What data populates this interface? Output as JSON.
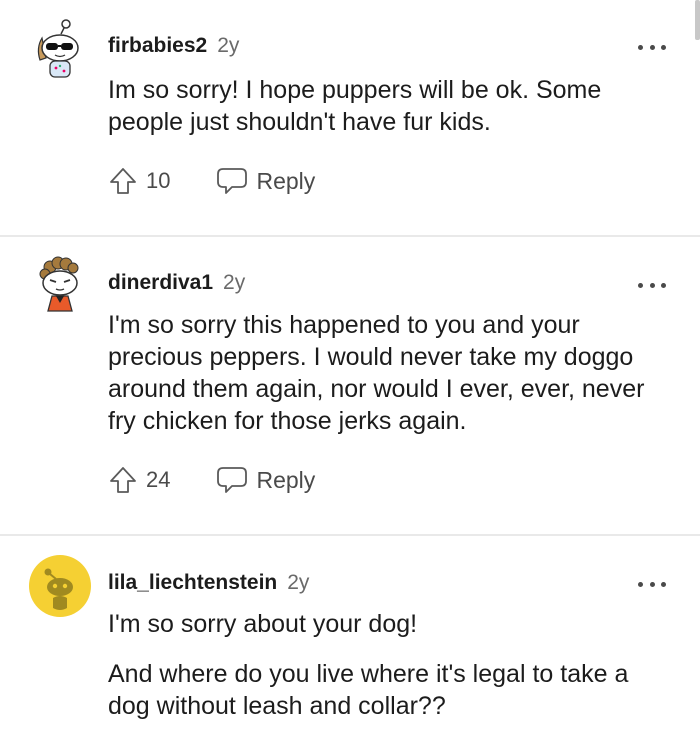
{
  "comments": [
    {
      "username": "firbabies2",
      "age": "2y",
      "body": [
        "Im so sorry! I hope puppers will be ok. Some people just shouldn't have fur kids."
      ],
      "upvotes": "10",
      "reply_label": "Reply",
      "avatar_icon": "snoo-sunglasses-avatar-icon"
    },
    {
      "username": "dinerdiva1",
      "age": "2y",
      "body": [
        "I'm so sorry this happened to you and your precious peppers. I would never take my doggo around them again, nor would I ever, ever, never fry chicken for those jerks again."
      ],
      "upvotes": "24",
      "reply_label": "Reply",
      "avatar_icon": "snoo-curly-hair-avatar-icon"
    },
    {
      "username": "lila_liechtenstein",
      "age": "2y",
      "body": [
        "I'm so sorry about your dog!",
        "And where do you live where it's legal to take a dog without leash and collar??"
      ],
      "avatar_icon": "snoo-default-yellow-avatar-icon"
    }
  ],
  "colors": {
    "text": "#1c1c1c",
    "muted": "#6a6a6a",
    "icon": "#4a4a4a",
    "divider": "#e9e9e9",
    "default_avatar_bg": "#f5d033"
  }
}
